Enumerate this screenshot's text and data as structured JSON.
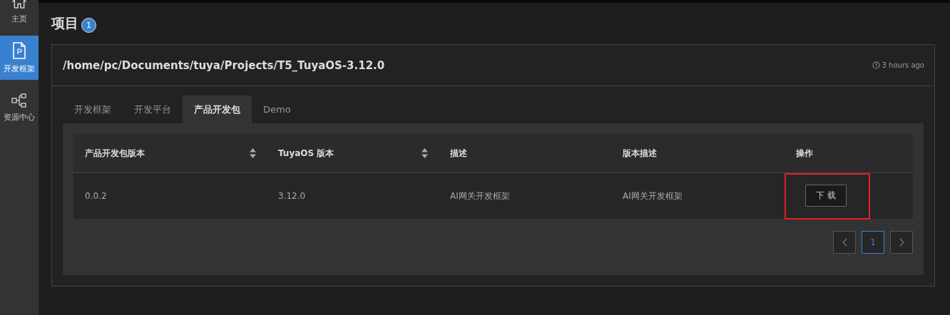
{
  "sidebar": {
    "items": [
      {
        "label": "主页",
        "kind": "home",
        "selected": false
      },
      {
        "label": "开发框架",
        "kind": "framework",
        "selected": true
      },
      {
        "label": "资源中心",
        "kind": "resources",
        "selected": false
      }
    ]
  },
  "page": {
    "title": "项目",
    "count": "1"
  },
  "project": {
    "path": "/home/pc/Documents/tuya/Projects/T5_TuyaOS-3.12.0",
    "updated": "3 hours ago"
  },
  "tabs": [
    {
      "label": "开发框架",
      "selected": false
    },
    {
      "label": "开发平台",
      "selected": false
    },
    {
      "label": "产品开发包",
      "selected": true
    },
    {
      "label": "Demo",
      "selected": false
    }
  ],
  "table": {
    "columns": [
      {
        "label": "产品开发包版本",
        "sortable": true
      },
      {
        "label": "TuyaOS 版本",
        "sortable": true
      },
      {
        "label": "描述",
        "sortable": false
      },
      {
        "label": "版本描述",
        "sortable": false
      },
      {
        "label": "操作",
        "sortable": false
      }
    ],
    "rows": [
      {
        "cells": [
          "0.0.2",
          "3.12.0",
          "AI网关开发框架",
          "AI网关开发框架"
        ],
        "action": "下 载",
        "action_highlighted": true
      }
    ]
  },
  "pagination": {
    "pages": [
      {
        "label": "1",
        "selected": true
      }
    ]
  }
}
